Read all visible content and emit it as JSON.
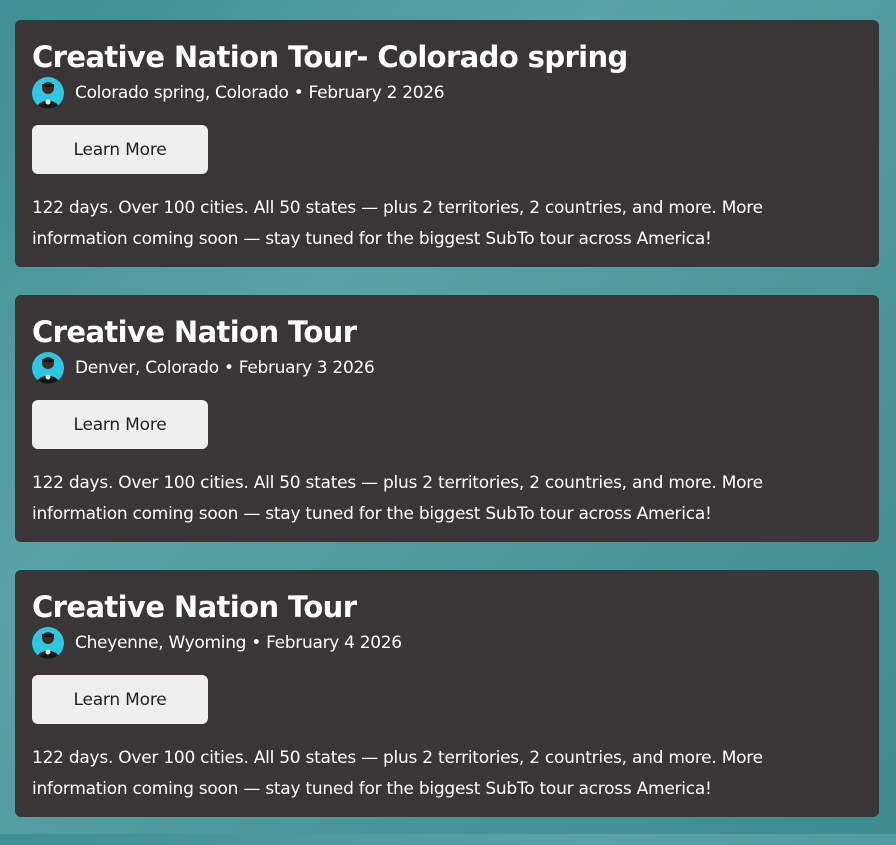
{
  "events": [
    {
      "title": "Creative Nation Tour- Colorado spring",
      "meta": "Colorado spring, Colorado • February 2 2026",
      "button_label": "Learn More",
      "description": "122 days. Over 100 cities. All 50 states — plus 2 territories, 2 countries, and more. More information coming soon — stay tuned for the biggest SubTo tour across America!"
    },
    {
      "title": "Creative Nation Tour",
      "meta": "Denver, Colorado • February 3 2026",
      "button_label": "Learn More",
      "description": "122 days. Over 100 cities. All 50 states — plus 2 territories, 2 countries, and more. More information coming soon — stay tuned for the biggest SubTo tour across America!"
    },
    {
      "title": "Creative Nation Tour",
      "meta": "Cheyenne, Wyoming • February 4 2026",
      "button_label": "Learn More",
      "description": "122 days. Over 100 cities. All 50 states — plus 2 territories, 2 countries, and more. More information coming soon — stay tuned for the biggest SubTo tour across America!"
    }
  ],
  "icons": {
    "avatar": "host-avatar-icon"
  },
  "colors": {
    "card_background": "#3a3536",
    "page_background": "#4a9599",
    "button_background": "#efefef",
    "text": "#ffffff"
  }
}
